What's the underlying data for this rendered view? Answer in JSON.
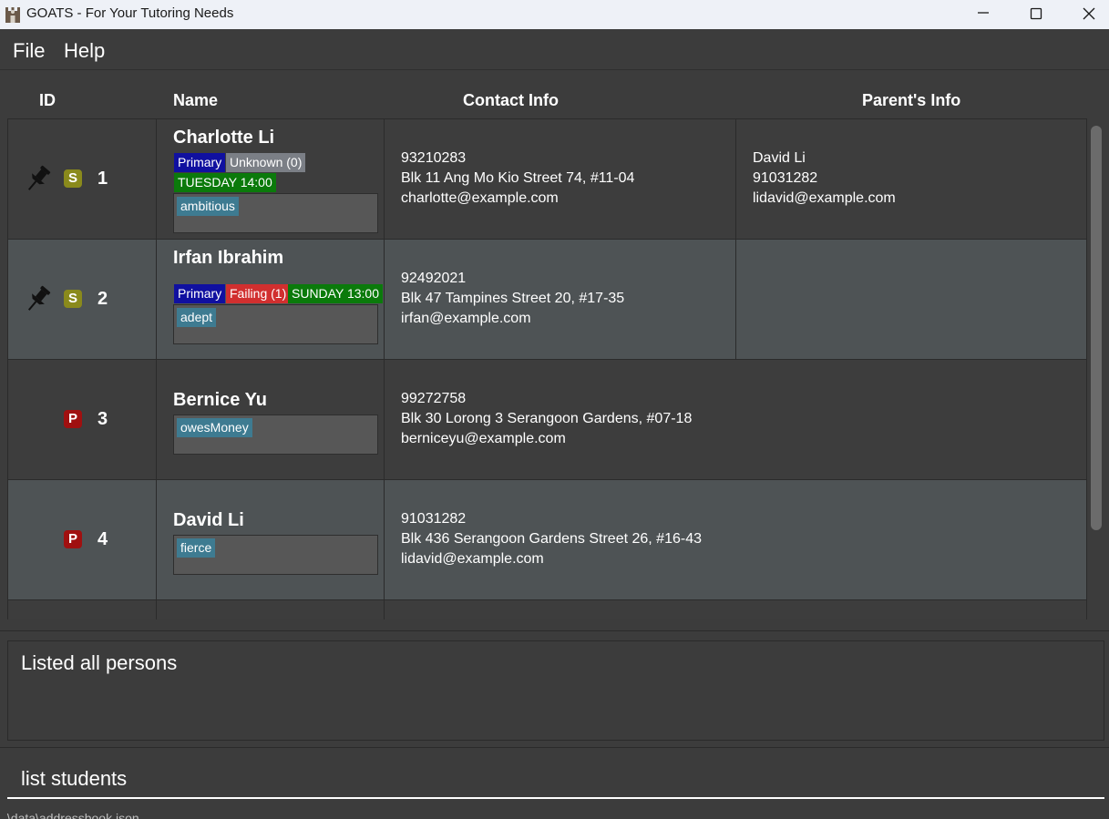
{
  "window": {
    "title": "GOATS - For Your Tutoring Needs",
    "icon": "goat-castle-icon",
    "controls": [
      "minimize-icon",
      "maximize-icon",
      "close-icon"
    ]
  },
  "menu": {
    "file": "File",
    "help": "Help"
  },
  "list": {
    "headers": {
      "id": "ID",
      "name": "Name",
      "contact": "Contact Info",
      "parent": "Parent's Info"
    },
    "rows": [
      {
        "pinned": true,
        "type_badge": "S",
        "id": "1",
        "name": "Charlotte Li",
        "labels": [
          "Primary",
          "Unknown (0)",
          "TUESDAY 14:00"
        ],
        "tags": [
          "ambitious"
        ],
        "phone": "93210283",
        "address": "Blk 11 Ang Mo Kio Street 74, #11-04",
        "email": "charlotte@example.com",
        "parent_name": "David Li",
        "parent_phone": "91031282",
        "parent_email": "lidavid@example.com"
      },
      {
        "pinned": true,
        "type_badge": "S",
        "id": "2",
        "name": "Irfan Ibrahim",
        "labels": [
          "Primary",
          "Failing (1)",
          "SUNDAY 13:00"
        ],
        "tags": [
          "adept"
        ],
        "phone": "92492021",
        "address": "Blk 47 Tampines Street 20, #17-35",
        "email": "irfan@example.com"
      },
      {
        "pinned": false,
        "type_badge": "P",
        "id": "3",
        "name": "Bernice Yu",
        "tags": [
          "owesMoney"
        ],
        "phone": "99272758",
        "address": "Blk 30 Lorong 3 Serangoon Gardens, #07-18",
        "email": "berniceyu@example.com"
      },
      {
        "pinned": false,
        "type_badge": "P",
        "id": "4",
        "name": "David Li",
        "tags": [
          "fierce"
        ],
        "phone": "91031282",
        "address": "Blk 436 Serangoon Gardens Street 26, #16-43",
        "email": "lidavid@example.com"
      }
    ]
  },
  "result": {
    "text": "Listed all persons"
  },
  "command": {
    "value": "list students"
  },
  "status": {
    "text": ".\\data\\addressbook.json"
  },
  "colors": {
    "background": "#3c3c3c",
    "row_light": "#4e5355",
    "badge_student": "#8a8a1c",
    "badge_parent": "#a01010",
    "label_level": "#1010a0",
    "label_grade_unknown": "#7b7f86",
    "label_grade_failing": "#d12f2f",
    "label_lesson": "#0b7a0b",
    "tag": "#3e7b91"
  }
}
